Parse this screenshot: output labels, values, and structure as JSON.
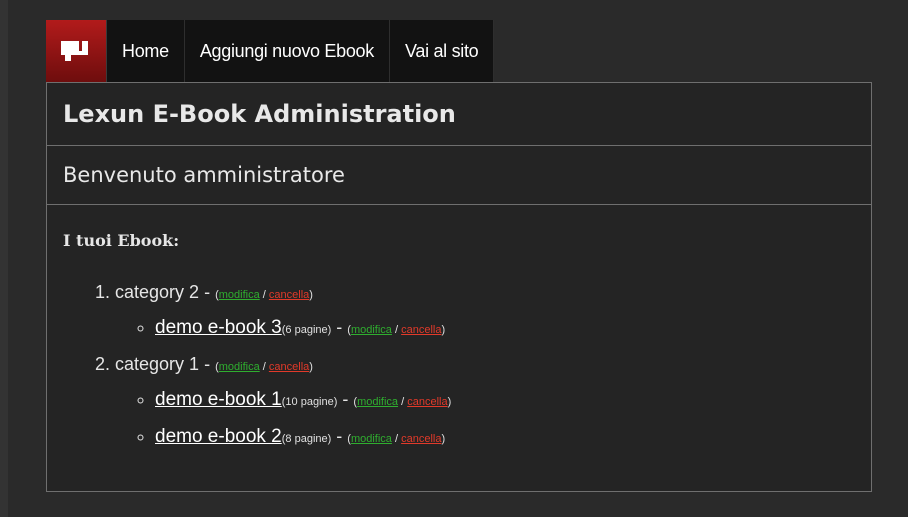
{
  "nav": {
    "logo_icon": "lexun-logo-icon",
    "items": [
      {
        "label": "Home"
      },
      {
        "label": "Aggiungi nuovo Ebook"
      },
      {
        "label": "Vai al sito"
      }
    ]
  },
  "header": {
    "title": "Lexun E-Book Administration",
    "welcome": "Benvenuto amministratore"
  },
  "main": {
    "section_title": "I tuoi Ebook:",
    "edit_label": "modifica",
    "delete_label": "cancella",
    "slash": "/",
    "dash": " - ",
    "categories": [
      {
        "name": "category 2",
        "books": [
          {
            "title": "demo e-book 3",
            "pages": "(6 pagine)"
          }
        ]
      },
      {
        "name": "category 1",
        "books": [
          {
            "title": "demo e-book 1",
            "pages": "(10 pagine)"
          },
          {
            "title": "demo e-book 2",
            "pages": "(8 pagine)"
          }
        ]
      }
    ]
  },
  "colors": {
    "background": "#333333",
    "panel": "#242424",
    "navbar": "#121212",
    "logo_red": "#b21b1b",
    "edit_green": "#2fae2f",
    "delete_red": "#e23a2a"
  }
}
